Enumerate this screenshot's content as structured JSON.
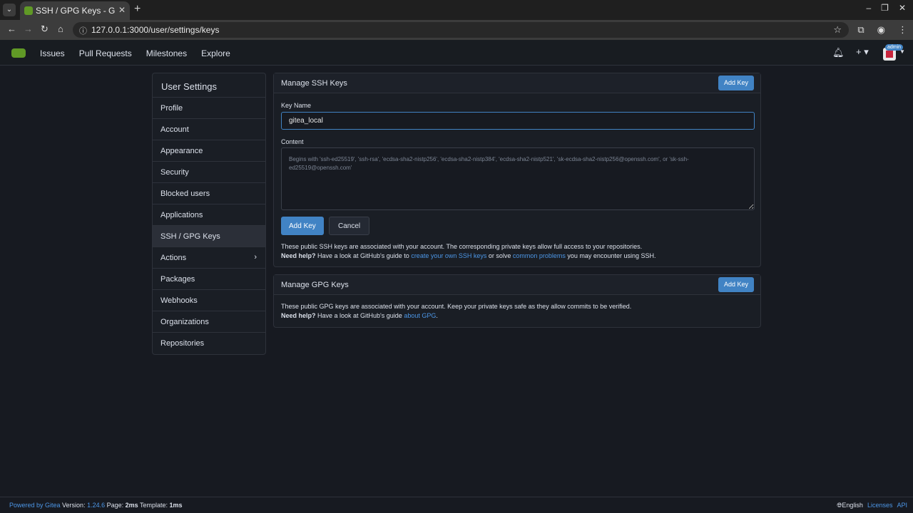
{
  "browser": {
    "tab_title": "SSH / GPG Keys - Gitea",
    "url": "127.0.0.1:3000/user/settings/keys"
  },
  "navbar": {
    "links": [
      "Issues",
      "Pull Requests",
      "Milestones",
      "Explore"
    ],
    "admin_badge": "admin"
  },
  "sidebar": {
    "header": "User Settings",
    "items": [
      {
        "label": "Profile"
      },
      {
        "label": "Account"
      },
      {
        "label": "Appearance"
      },
      {
        "label": "Security"
      },
      {
        "label": "Blocked users"
      },
      {
        "label": "Applications"
      },
      {
        "label": "SSH / GPG Keys",
        "active": true
      },
      {
        "label": "Actions"
      },
      {
        "label": "Packages"
      },
      {
        "label": "Webhooks"
      },
      {
        "label": "Organizations"
      },
      {
        "label": "Repositories"
      }
    ]
  },
  "ssh_panel": {
    "title": "Manage SSH Keys",
    "add_key_label": "Add Key",
    "key_name_label": "Key Name",
    "key_name_value": "gitea_local",
    "content_label": "Content",
    "content_placeholder": "Begins with 'ssh-ed25519', 'ssh-rsa', 'ecdsa-sha2-nistp256', 'ecdsa-sha2-nistp384', 'ecdsa-sha2-nistp521', 'sk-ecdsa-sha2-nistp256@openssh.com', or 'sk-ssh-ed25519@openssh.com'",
    "submit_label": "Add Key",
    "cancel_label": "Cancel",
    "info_line": "These public SSH keys are associated with your account. The corresponding private keys allow full access to your repositories.",
    "help_bold": "Need help?",
    "help_text_1": " Have a look at GitHub's guide to ",
    "help_link_1": "create your own SSH keys",
    "help_text_2": " or solve ",
    "help_link_2": "common problems",
    "help_text_3": " you may encounter using SSH."
  },
  "gpg_panel": {
    "title": "Manage GPG Keys",
    "add_key_label": "Add Key",
    "info_line": "These public GPG keys are associated with your account. Keep your private keys safe as they allow commits to be verified.",
    "help_bold": "Need help?",
    "help_text_1": " Have a look at GitHub's guide ",
    "help_link_1": "about GPG",
    "help_text_2": "."
  },
  "footer": {
    "powered_by": "Powered by Gitea",
    "version_label": " Version: ",
    "version": "1.24.6",
    "page_label": " Page: ",
    "page_time": "2ms",
    "template_label": " Template: ",
    "template_time": "1ms",
    "language": "English",
    "licenses": "Licenses",
    "api": "API"
  }
}
